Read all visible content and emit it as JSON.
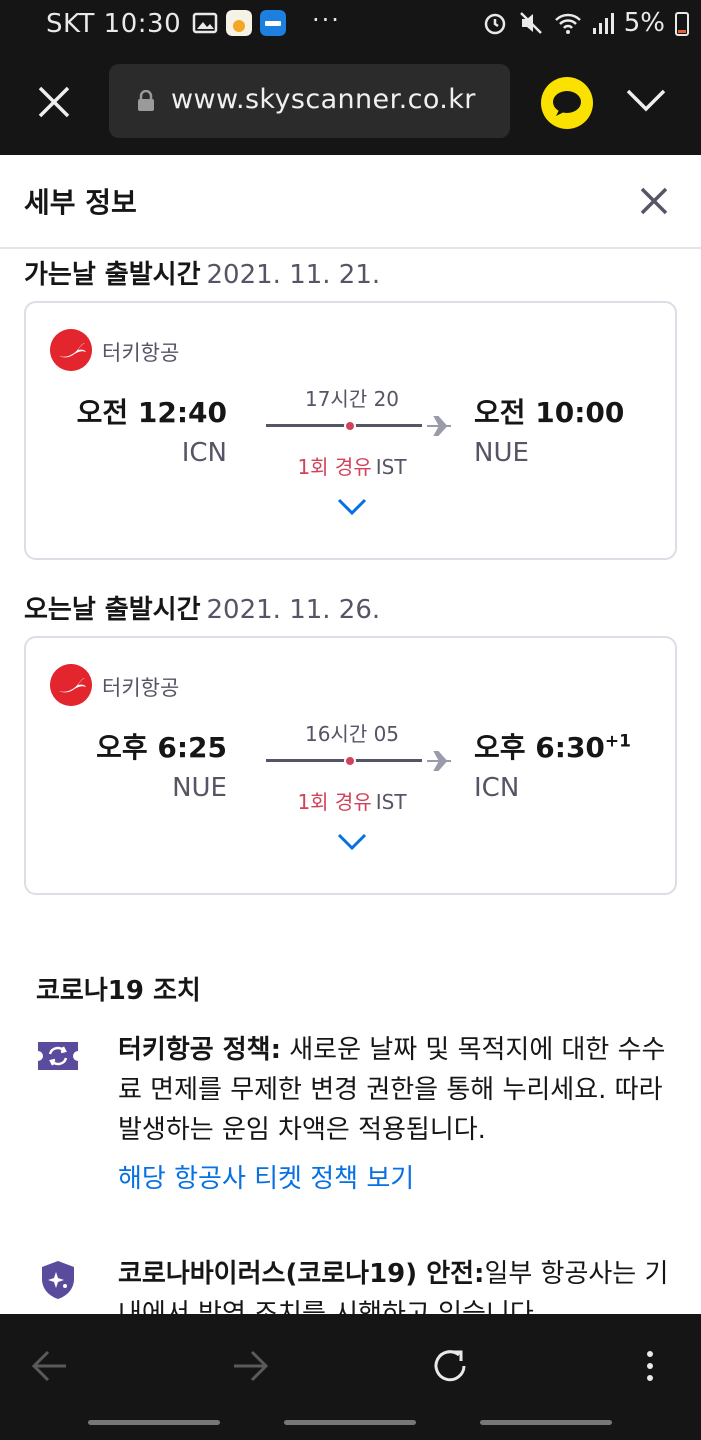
{
  "status_bar": {
    "carrier_time": "SKT 10:30",
    "battery": "5%",
    "overflow": "···"
  },
  "browser": {
    "url": "www.skyscanner.co.kr"
  },
  "panel": {
    "title": "세부 정보"
  },
  "outbound": {
    "label": "가는날 출발시간",
    "date": "2021. 11. 21.",
    "airline": "터키항공",
    "dep_time": "오전 12:40",
    "dep_code": "ICN",
    "arr_time": "오전 10:00",
    "arr_code": "NUE",
    "duration": "17시간 20",
    "stops": "1회 경유",
    "via": "IST"
  },
  "inbound": {
    "label": "오는날 출발시간",
    "date": "2021. 11. 26.",
    "airline": "터키항공",
    "dep_time": "오후 6:25",
    "dep_code": "NUE",
    "arr_time": "오후 6:30",
    "arr_day_offset": "+1",
    "arr_code": "ICN",
    "duration": "16시간 05",
    "stops": "1회 경유",
    "via": "IST"
  },
  "covid": {
    "title": "코로나19 조치",
    "policy_label": "터키항공 정책:",
    "policy_text": "새로운 날짜 및 목적지에 대한 수수료 면제를 무제한 변경 권한을 통해 누리세요. 따라 발생하는 운임 차액은 적용됩니다.",
    "policy_link": "해당 항공사 티켓 정책 보기",
    "safety_label": "코로나바이러스(코로나19) 안전:",
    "safety_text": "일부 항공사는 기내에서 방역 조치를 시행하고 있습니다."
  },
  "colors": {
    "accent_link": "#0770e3",
    "stop_red": "#d1435b",
    "airline_red": "#e3262e",
    "talk_yellow": "#fae100"
  }
}
